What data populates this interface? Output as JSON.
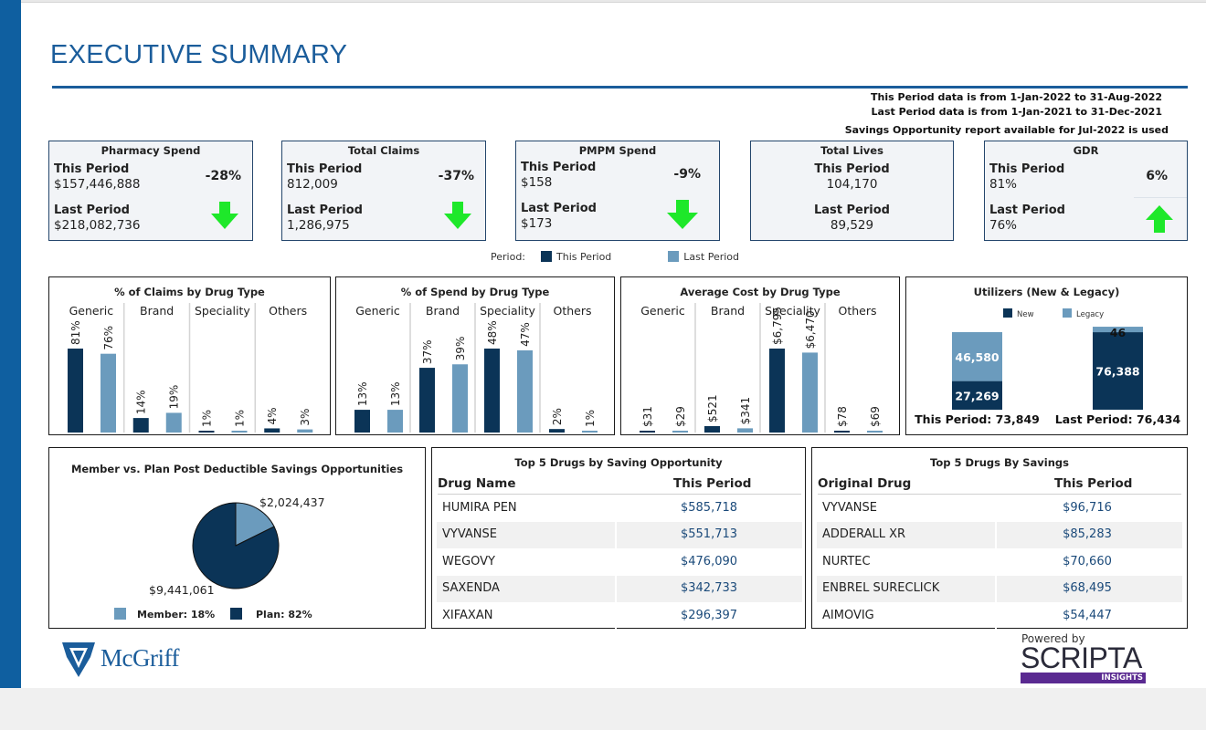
{
  "title": "EXECUTIVE SUMMARY",
  "info": {
    "this_period": "This Period data is from 1-Jan-2022 to 31-Aug-2022",
    "last_period": "Last Period data is from 1-Jan-2021 to 31-Dec-2021",
    "savings_note": "Savings Opportunity report available for Jul-2022 is used"
  },
  "kpis": {
    "pharmacy": {
      "title": "Pharmacy Spend",
      "this_label": "This Period",
      "this_value": "$157,446,888",
      "last_label": "Last Period",
      "last_value": "$218,082,736",
      "change": "-28%",
      "direction": "down"
    },
    "claims": {
      "title": "Total Claims",
      "this_label": "This Period",
      "this_value": "812,009",
      "last_label": "Last Period",
      "last_value": "1,286,975",
      "change": "-37%",
      "direction": "down"
    },
    "pmpm": {
      "title": "PMPM Spend",
      "this_label": "This Period",
      "this_value": "$158",
      "last_label": "Last Period",
      "last_value": "$173",
      "change": "-9%",
      "direction": "down"
    },
    "lives": {
      "title": "Total Lives",
      "this_label": "This Period",
      "this_value": "104,170",
      "last_label": "Last Period",
      "last_value": "89,529"
    },
    "gdr": {
      "title": "GDR",
      "this_label": "This Period",
      "this_value": "81%",
      "last_label": "Last Period",
      "last_value": "76%",
      "change": "6%",
      "direction": "up"
    }
  },
  "period_legend": {
    "label": "Period:",
    "this": "This Period",
    "last": "Last Period"
  },
  "colors": {
    "this_period": "#0b3457",
    "last_period": "#6b9bbd",
    "arrow": "#1ee82a",
    "accent": "#1b5d9b"
  },
  "chart_data": [
    {
      "type": "bar",
      "title": "% of Claims by Drug Type",
      "categories": [
        "Generic",
        "Brand",
        "Speciality",
        "Others"
      ],
      "series": [
        {
          "name": "This Period",
          "values": [
            81,
            14,
            1,
            4
          ]
        },
        {
          "name": "Last Period",
          "values": [
            76,
            19,
            1,
            3
          ]
        }
      ],
      "labels": [
        [
          "81%",
          "76%"
        ],
        [
          "14%",
          "19%"
        ],
        [
          "1%",
          "1%"
        ],
        [
          "4%",
          "3%"
        ]
      ],
      "ylim": [
        0,
        81
      ]
    },
    {
      "type": "bar",
      "title": "% of Spend by Drug Type",
      "categories": [
        "Generic",
        "Brand",
        "Speciality",
        "Others"
      ],
      "series": [
        {
          "name": "This Period",
          "values": [
            13,
            37,
            48,
            2
          ]
        },
        {
          "name": "Last Period",
          "values": [
            13,
            39,
            47,
            1
          ]
        }
      ],
      "labels": [
        [
          "13%",
          "13%"
        ],
        [
          "37%",
          "39%"
        ],
        [
          "48%",
          "47%"
        ],
        [
          "2%",
          "1%"
        ]
      ],
      "ylim": [
        0,
        48
      ]
    },
    {
      "type": "bar",
      "title": "Average Cost by Drug Type",
      "categories": [
        "Generic",
        "Brand",
        "Speciality",
        "Others"
      ],
      "series": [
        {
          "name": "This Period",
          "values": [
            31,
            521,
            6795,
            78
          ]
        },
        {
          "name": "Last Period",
          "values": [
            29,
            341,
            6470,
            69
          ]
        }
      ],
      "labels": [
        [
          "$31",
          "$29"
        ],
        [
          "$521",
          "$341"
        ],
        [
          "$6,795",
          "$6,470"
        ],
        [
          "$78",
          "$69"
        ]
      ],
      "ylim": [
        0,
        6795
      ]
    },
    {
      "type": "bar",
      "title": "Utilizers (New & Legacy)",
      "stacked": true,
      "categories": [
        "This Period: 73,849",
        "Last Period: 76,434"
      ],
      "series": [
        {
          "name": "New",
          "values": [
            27269,
            76388
          ]
        },
        {
          "name": "Legacy",
          "values": [
            46580,
            46
          ]
        }
      ],
      "labels": [
        [
          "27,269",
          "46,580"
        ],
        [
          "76,388",
          "46"
        ]
      ]
    },
    {
      "type": "pie",
      "title": "Member vs. Plan Post Deductible Savings Opportunities",
      "categories": [
        "Member",
        "Plan"
      ],
      "values": [
        2024437,
        9441061
      ],
      "labels": [
        "$2,024,437",
        "$9,441,061"
      ],
      "legend": [
        "Member: 18%",
        "Plan: 82%"
      ]
    }
  ],
  "top_opportunity": {
    "title": "Top 5 Drugs by Saving Opportunity",
    "col1": "Drug Name",
    "col2": "This Period",
    "rows": [
      [
        "HUMIRA PEN",
        "$585,718"
      ],
      [
        "VYVANSE",
        "$551,713"
      ],
      [
        "WEGOVY",
        "$476,090"
      ],
      [
        "SAXENDA",
        "$342,733"
      ],
      [
        "XIFAXAN",
        "$296,397"
      ]
    ]
  },
  "top_savings": {
    "title": "Top 5 Drugs By Savings",
    "col1": "Original Drug",
    "col2": "This Period",
    "rows": [
      [
        "VYVANSE",
        "$96,716"
      ],
      [
        "ADDERALL XR",
        "$85,283"
      ],
      [
        "NURTEC",
        "$70,660"
      ],
      [
        "ENBREL SURECLICK",
        "$68,495"
      ],
      [
        "AIMOVIG",
        "$54,447"
      ]
    ]
  },
  "logos": {
    "mcgriff": "McGriff",
    "powered_by": "Powered by",
    "scripta": "SCRIPTA",
    "insights": "INSIGHTS"
  }
}
